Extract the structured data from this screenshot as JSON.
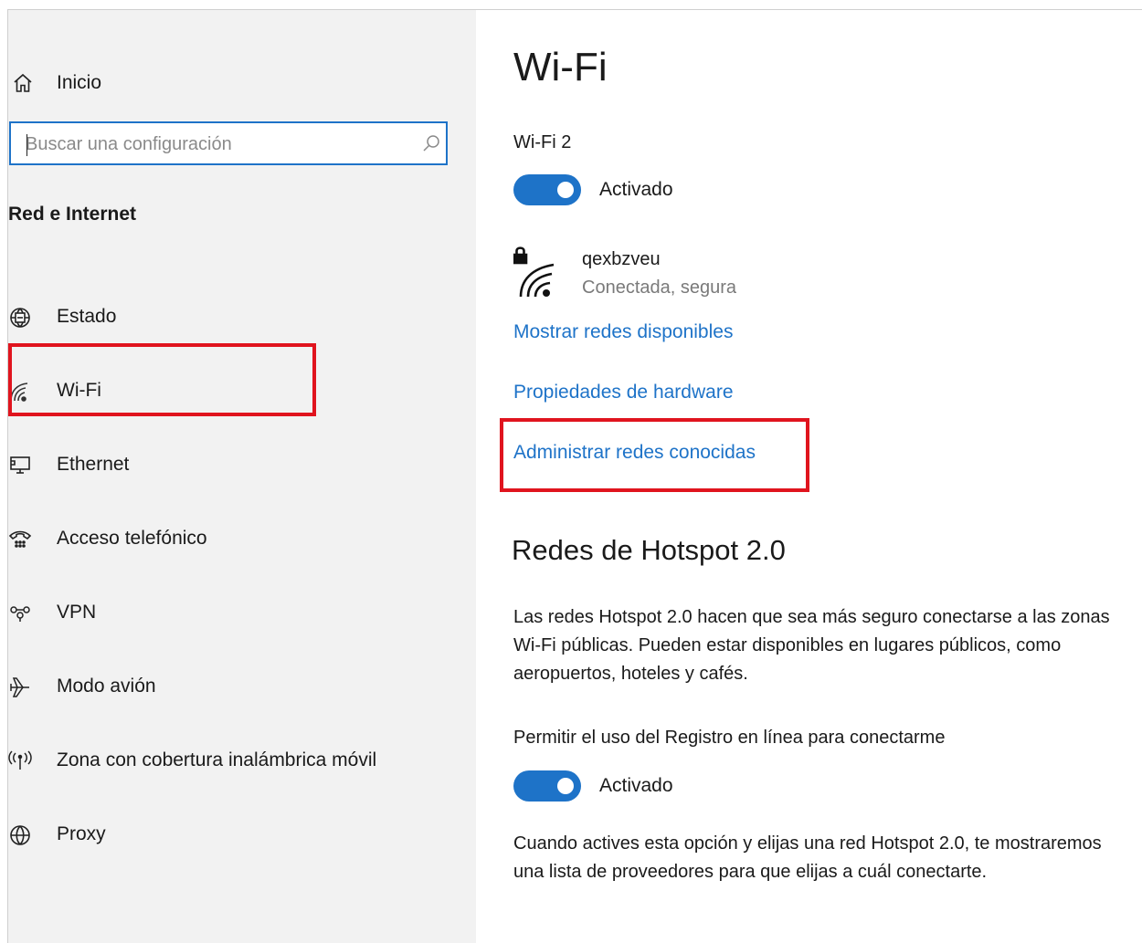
{
  "sidebar": {
    "home_label": "Inicio",
    "search_placeholder": "Buscar una configuración",
    "section_title": "Red e Internet",
    "items": [
      {
        "label": "Estado",
        "icon": "globe-status-icon"
      },
      {
        "label": "Wi-Fi",
        "icon": "wifi-icon"
      },
      {
        "label": "Ethernet",
        "icon": "ethernet-monitor-icon"
      },
      {
        "label": "Acceso telefónico",
        "icon": "dialup-phone-icon"
      },
      {
        "label": "VPN",
        "icon": "vpn-icon"
      },
      {
        "label": "Modo avión",
        "icon": "airplane-icon"
      },
      {
        "label": "Zona con cobertura inalámbrica móvil",
        "icon": "hotspot-icon"
      },
      {
        "label": "Proxy",
        "icon": "globe-icon"
      }
    ],
    "selected_item": "Wi-Fi"
  },
  "main": {
    "title": "Wi-Fi",
    "adapter_name": "Wi-Fi 2",
    "wifi_toggle": {
      "state": "on",
      "label": "Activado"
    },
    "network": {
      "ssid": "qexbzveu",
      "status": "Conectada, segura",
      "icon": "wifi-secured-icon"
    },
    "links": {
      "show_networks": "Mostrar redes disponibles",
      "hardware_properties": "Propiedades de hardware",
      "manage_known": "Administrar redes conocidas"
    },
    "hotspot": {
      "heading": "Redes de Hotspot 2.0",
      "description_lines": [
        "Las redes Hotspot 2.0 hacen que sea más seguro conectarse a las zonas",
        "Wi-Fi públicas. Pueden estar disponibles en lugares públicos, como",
        "aeropuertos, hoteles y cafés."
      ],
      "online_signup_caption": "Permitir el uso del Registro en línea para conectarme",
      "online_signup_toggle": {
        "state": "on",
        "label": "Activado"
      },
      "footer_lines": [
        "Cuando actives esta opción y elijas una red Hotspot 2.0, te mostraremos",
        "una lista de proveedores para que elijas a cuál conectarte."
      ]
    }
  },
  "colors": {
    "accent": "#1e73c8",
    "highlight": "#e0141e",
    "sidebar_bg": "#f2f2f2"
  }
}
